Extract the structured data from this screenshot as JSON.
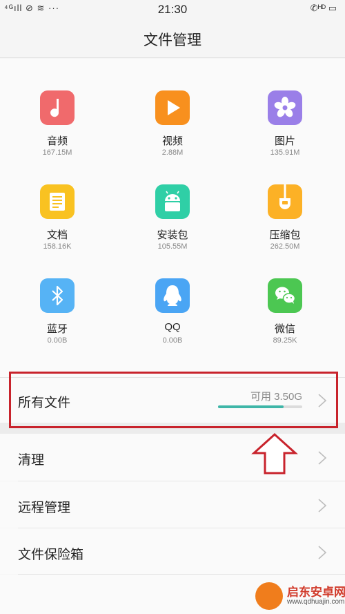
{
  "status_bar": {
    "left_indicators": "⁴ᴳıll ⊘ ≋ ···",
    "time": "21:30",
    "right_indicators": "✆ᴴᴰ ▭"
  },
  "header": {
    "title": "文件管理"
  },
  "categories": [
    {
      "label": "音频",
      "size": "167.15M",
      "icon": "music-icon",
      "color": "#f06a6c"
    },
    {
      "label": "视频",
      "size": "2.88M",
      "icon": "play-icon",
      "color": "#f8901e"
    },
    {
      "label": "图片",
      "size": "135.91M",
      "icon": "flower-icon",
      "color": "#9a7fe8"
    },
    {
      "label": "文档",
      "size": "158.16K",
      "icon": "document-icon",
      "color": "#f9c221"
    },
    {
      "label": "安装包",
      "size": "105.55M",
      "icon": "android-icon",
      "color": "#2fcfa6"
    },
    {
      "label": "压缩包",
      "size": "262.50M",
      "icon": "archive-icon",
      "color": "#fcb126"
    },
    {
      "label": "蓝牙",
      "size": "0.00B",
      "icon": "bluetooth-icon",
      "color": "#56b3f5"
    },
    {
      "label": "QQ",
      "size": "0.00B",
      "icon": "qq-penguin-icon",
      "color": "#4aa5f4"
    },
    {
      "label": "微信",
      "size": "89.25K",
      "icon": "wechat-icon",
      "color": "#4cc752"
    }
  ],
  "all_files": {
    "label": "所有文件",
    "available": "可用 3.50G",
    "used_fraction": 0.78
  },
  "menu": [
    {
      "label": "清理"
    },
    {
      "label": "远程管理"
    },
    {
      "label": "文件保险箱"
    }
  ],
  "colors": {
    "accent": "#3fb6a8",
    "annotation": "#c8232c"
  },
  "watermark": {
    "name": "启东安卓网",
    "url": "www.qdhuajin.com"
  }
}
